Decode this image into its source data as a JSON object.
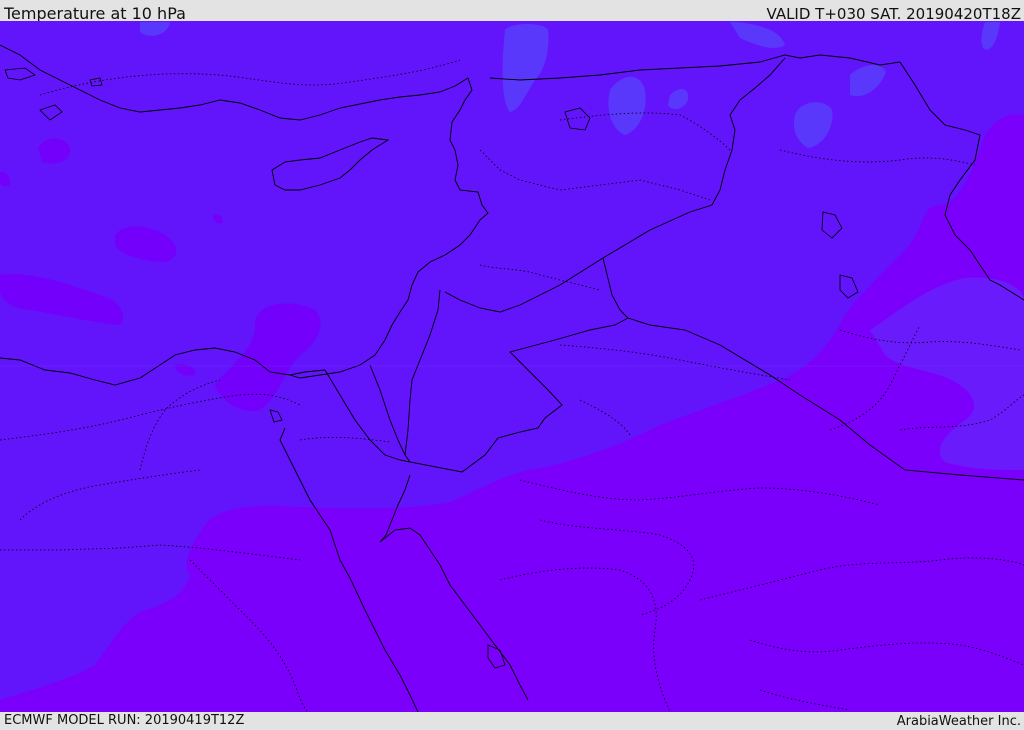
{
  "header": {
    "title": "Temperature at 10 hPa",
    "valid": "VALID T+030 SAT. 20190420T18Z"
  },
  "footer": {
    "model_run": "ECMWF MODEL RUN: 20190419T12Z",
    "credit": "ArabiaWeather Inc."
  },
  "map": {
    "field": "temperature-10hPa",
    "colors": {
      "blue_violet": "#6214fb",
      "violet": "#7a00fb",
      "light_blue": "#5a38fb",
      "border": "#000000"
    }
  }
}
